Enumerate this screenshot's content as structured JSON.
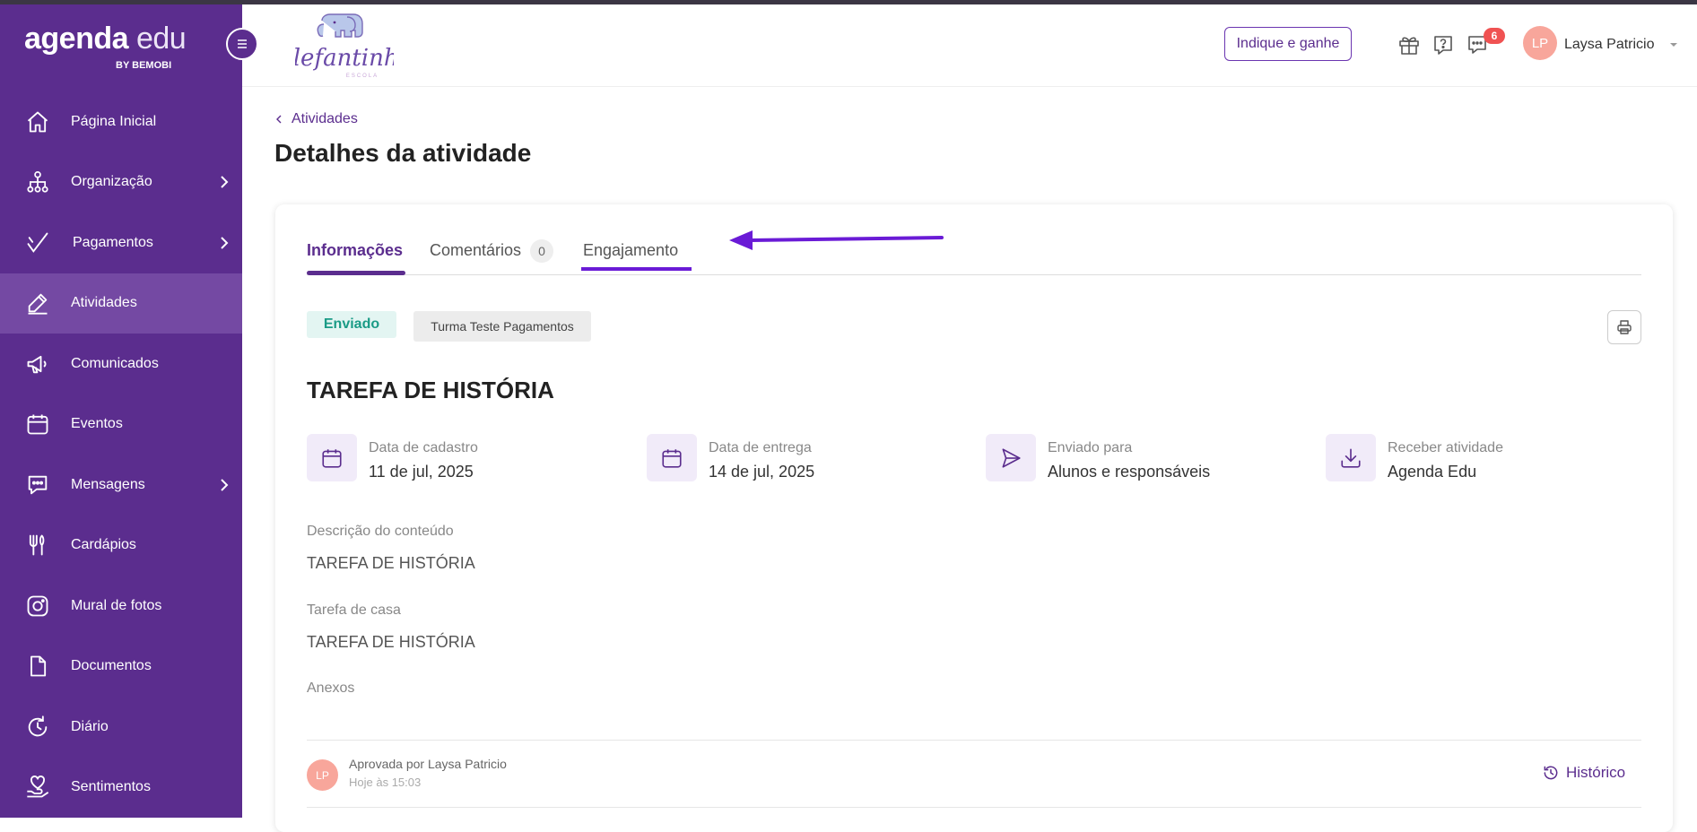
{
  "sidebar": {
    "brand_main": "agenda",
    "brand_light": " edu",
    "brand_by": "BY BEMOBI",
    "items": [
      {
        "label": "Página Inicial",
        "icon": "home-icon",
        "has_children": false,
        "active": false
      },
      {
        "label": "Organização",
        "icon": "org-chart-icon",
        "has_children": true,
        "active": false
      },
      {
        "label": "Pagamentos",
        "icon": "check-icon",
        "has_children": true,
        "active": false
      },
      {
        "label": "Atividades",
        "icon": "pencil-icon",
        "has_children": false,
        "active": true
      },
      {
        "label": "Comunicados",
        "icon": "megaphone-icon",
        "has_children": false,
        "active": false
      },
      {
        "label": "Eventos",
        "icon": "calendar-icon",
        "has_children": false,
        "active": false
      },
      {
        "label": "Mensagens",
        "icon": "chat-icon",
        "has_children": true,
        "active": false
      },
      {
        "label": "Cardápios",
        "icon": "utensils-icon",
        "has_children": false,
        "active": false
      },
      {
        "label": "Mural de fotos",
        "icon": "camera-icon",
        "has_children": false,
        "active": false
      },
      {
        "label": "Documentos",
        "icon": "document-icon",
        "has_children": false,
        "active": false
      },
      {
        "label": "Diário",
        "icon": "refresh-clock-icon",
        "has_children": false,
        "active": false
      },
      {
        "label": "Sentimentos",
        "icon": "heart-hand-icon",
        "has_children": false,
        "active": false
      }
    ]
  },
  "header": {
    "school_name": "Elefantinho",
    "school_sub": "ESCOLA",
    "indique_label": "Indique e ganhe",
    "notification_count": "6",
    "user_initials": "LP",
    "user_name": "Laysa Patricio"
  },
  "page": {
    "breadcrumb": "Atividades",
    "title": "Detalhes da atividade"
  },
  "tabs": [
    {
      "label": "Informações",
      "active": true
    },
    {
      "label": "Comentários",
      "count": "0",
      "active": false
    },
    {
      "label": "Engajamento",
      "active": false
    }
  ],
  "activity": {
    "status": "Enviado",
    "class_name": "Turma Teste Pagamentos",
    "title": "TAREFA DE HISTÓRIA",
    "info": [
      {
        "label": "Data de cadastro",
        "value": "11 de jul, 2025",
        "icon": "calendar-icon"
      },
      {
        "label": "Data de entrega",
        "value": "14 de jul, 2025",
        "icon": "calendar-icon"
      },
      {
        "label": "Enviado para",
        "value": "Alunos e responsáveis",
        "icon": "send-icon"
      },
      {
        "label": "Receber atividade",
        "value": "Agenda Edu",
        "icon": "download-icon"
      }
    ],
    "description_label": "Descrição do conteúdo",
    "description": "TAREFA DE HISTÓRIA",
    "homework_label": "Tarefa de casa",
    "homework": "TAREFA DE HISTÓRIA",
    "attachments_label": "Anexos",
    "approver_initials": "LP",
    "approved_by": "Aprovada por Laysa Patricio",
    "approved_time": "Hoje às 15:03",
    "history_label": "Histórico"
  },
  "colors": {
    "sidebar": "#5b2d8e",
    "sidebar_active": "#7449a3",
    "accent": "#5b2d8e",
    "status_bg": "#e3f5f2",
    "status_text": "#1a9b86",
    "annotation": "#6a1bd6",
    "badge": "#f05252",
    "avatar": "#f8a69b"
  }
}
